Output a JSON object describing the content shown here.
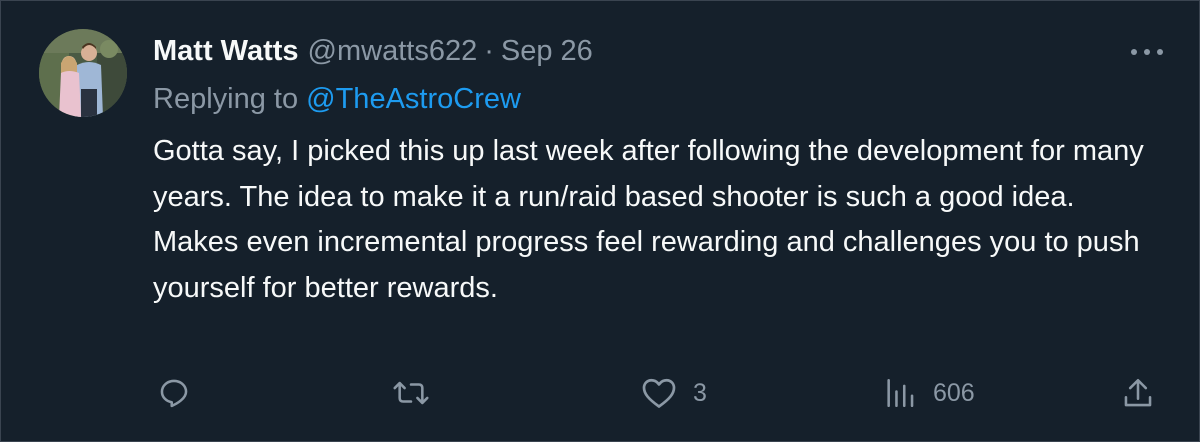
{
  "tweet": {
    "display_name": "Matt Watts",
    "handle": "@mwatts622",
    "separator": "·",
    "date": "Sep 26",
    "replying_prefix": "Replying to",
    "replying_to": "@TheAstroCrew",
    "text": "Gotta say, I picked this up last week after following the development for many years. The idea to make it a run/raid based shooter is such a good idea. Makes even incremental progress feel rewarding and challenges you to push yourself for better rewards."
  },
  "actions": {
    "reply": {
      "icon": "reply-icon"
    },
    "retweet": {
      "icon": "retweet-icon"
    },
    "like": {
      "icon": "heart-icon",
      "count": "3"
    },
    "views": {
      "icon": "views-chart-icon",
      "count": "606"
    },
    "share": {
      "icon": "share-icon"
    }
  },
  "colors": {
    "background": "#15202b",
    "text_primary": "#f7f9f9",
    "text_secondary": "#8b98a5",
    "link": "#1d9bf0",
    "border": "#3a4450"
  }
}
